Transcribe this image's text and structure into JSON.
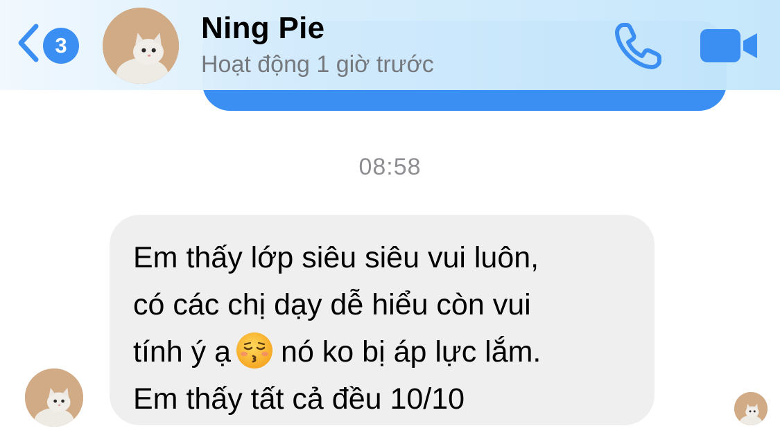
{
  "header": {
    "unread_count": "3",
    "contact_name": "Ning Pie",
    "status": "Hoạt động 1 giờ trước",
    "icons": {
      "back": "chevron-left-icon",
      "call": "phone-icon",
      "video": "video-camera-icon"
    },
    "accent_color": "#3b8ff3"
  },
  "conversation": {
    "timestamp": "08:58",
    "incoming_message": {
      "lines": [
        "Em thấy lớp siêu siêu vui luôn,",
        "có các chị dạy dễ hiểu còn vui",
        "tính ý ạ",
        "nó ko bị áp lực lắm.",
        "Em thấy tất cả đều 10/10"
      ],
      "emoji": "kissing-face-with-closed-eyes-icon",
      "bubble_color": "#efefef"
    },
    "outgoing_bubble_color": "#3b8ff3"
  }
}
